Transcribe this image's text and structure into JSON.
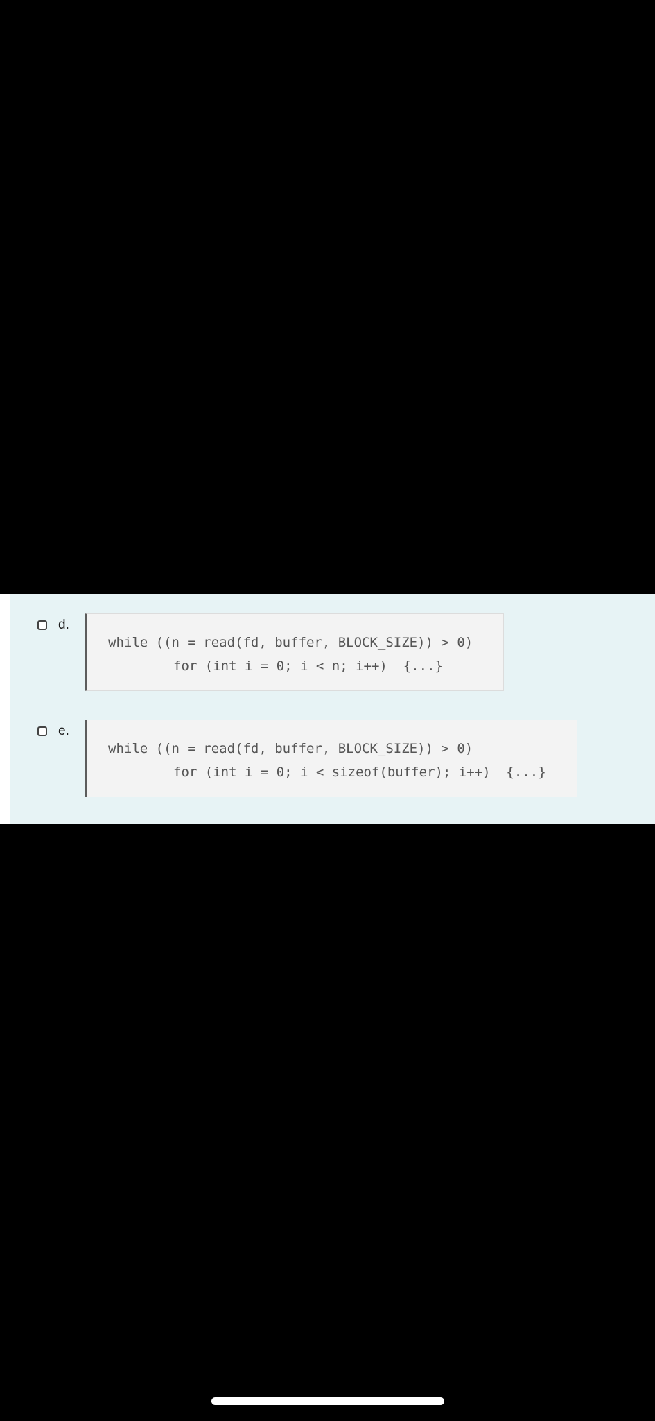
{
  "options": [
    {
      "letter": "d.",
      "code": {
        "line1": "while ((n = read(fd, buffer, BLOCK_SIZE)) > 0)",
        "line2": "for (int i = 0; i < n; i++)  {...}"
      },
      "checked": false
    },
    {
      "letter": "e.",
      "code": {
        "line1": "while ((n = read(fd, buffer, BLOCK_SIZE)) > 0)",
        "line2": "for (int i = 0; i < sizeof(buffer); i++)  {...}"
      },
      "checked": false
    }
  ],
  "colors": {
    "panel_background": "#e7f3f5",
    "code_background": "#f3f3f3",
    "code_border_accent": "#5c5c5c",
    "code_text": "#555555",
    "screen_background": "#000000"
  },
  "icons": {
    "checkbox": "checkbox-unchecked-icon"
  }
}
